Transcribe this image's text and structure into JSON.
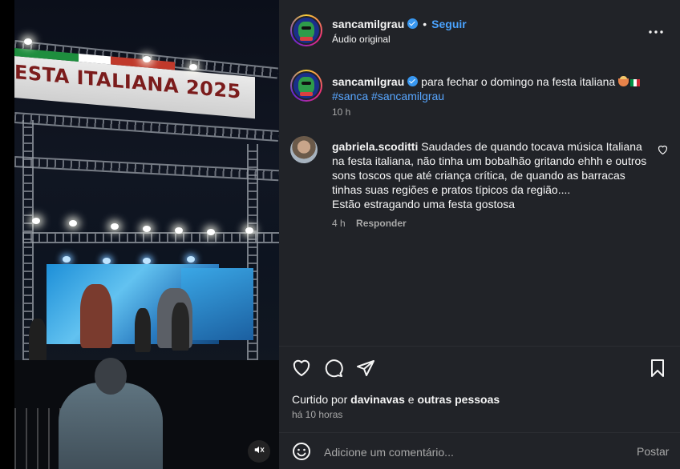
{
  "media": {
    "banner_text": "ESTA ITALIANA 2025",
    "mute_icon": "speaker-muted-icon"
  },
  "header": {
    "username": "sancamilgrau",
    "separator": "•",
    "follow_label": "Seguir",
    "audio_label": "Áudio original",
    "more_icon": "more-horizontal-icon"
  },
  "caption": {
    "username": "sancamilgrau",
    "text": "para fechar o domingo na festa italiana",
    "hashtags": [
      "#sanca",
      "#sancamilgrau"
    ],
    "time": "10 h"
  },
  "comment": {
    "username": "gabriela.scoditti",
    "text": "Saudades de quando tocava música Italiana na festa italiana, não tinha um bobalhão gritando ehhh e outros sons toscos que até criança crítica, de quando as barracas tinhas suas regiões e pratos típicos da região....",
    "text_line2": "Estão estragando uma festa gostosa",
    "time": "4 h",
    "reply_label": "Responder"
  },
  "actions": {
    "icons": [
      "heart-icon",
      "comment-icon",
      "share-icon",
      "bookmark-icon"
    ]
  },
  "likes": {
    "prefix": "Curtido por",
    "user": "davinavas",
    "conjunction": "e",
    "others": "outras pessoas"
  },
  "post_time": "há 10 horas",
  "add_comment": {
    "placeholder": "Adicione um comentário...",
    "post_label": "Postar"
  },
  "colors": {
    "panel_bg": "#212328",
    "link_blue": "#4aa3ff",
    "hashtag_blue": "#58a6ff",
    "muted_text": "#a8a8a8"
  }
}
